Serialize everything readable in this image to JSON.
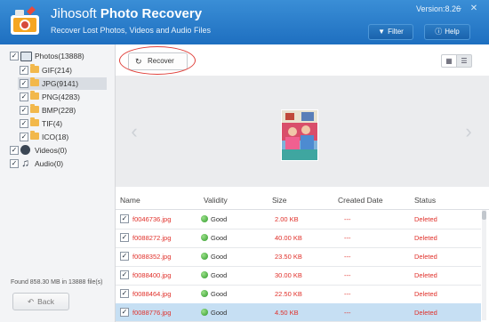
{
  "header": {
    "app_name_light": "Jihosoft ",
    "app_name_bold": "Photo Recovery",
    "subtitle": "Recover Lost Photos, Videos and Audio Files",
    "version": "Version:8.26",
    "filter_label": "Filter",
    "help_label": "Help",
    "accent": "#2b7fcf"
  },
  "sidebar": {
    "items": [
      {
        "label": "Photos(13888)",
        "icon": "photos-icon"
      },
      {
        "label": "GIF(214)",
        "icon": "folder-icon"
      },
      {
        "label": "JPG(9141)",
        "icon": "folder-icon",
        "selected": true
      },
      {
        "label": "PNG(4283)",
        "icon": "folder-icon"
      },
      {
        "label": "BMP(228)",
        "icon": "folder-icon"
      },
      {
        "label": "TIF(4)",
        "icon": "folder-icon"
      },
      {
        "label": "ICO(18)",
        "icon": "folder-icon"
      },
      {
        "label": "Videos(0)",
        "icon": "film-reel-icon"
      },
      {
        "label": "Audio(0)",
        "icon": "music-note-icon"
      }
    ],
    "found_text": "Found 858.30 MB in 13888 file(s)",
    "back_label": "Back"
  },
  "toolbar": {
    "recover_label": "Recover"
  },
  "table": {
    "columns": [
      "Name",
      "Validity",
      "Size",
      "Created Date",
      "Status"
    ],
    "rows": [
      {
        "name": "f0046736.jpg",
        "validity": "Good",
        "size": "2.00 KB",
        "created": "---",
        "status": "Deleted"
      },
      {
        "name": "f0088272.jpg",
        "validity": "Good",
        "size": "40.00 KB",
        "created": "---",
        "status": "Deleted"
      },
      {
        "name": "f0088352.jpg",
        "validity": "Good",
        "size": "23.50 KB",
        "created": "---",
        "status": "Deleted"
      },
      {
        "name": "f0088400.jpg",
        "validity": "Good",
        "size": "30.00 KB",
        "created": "---",
        "status": "Deleted"
      },
      {
        "name": "f0088464.jpg",
        "validity": "Good",
        "size": "22.50 KB",
        "created": "---",
        "status": "Deleted"
      },
      {
        "name": "f0088776.jpg",
        "validity": "Good",
        "size": "4.50 KB",
        "created": "---",
        "status": "Deleted",
        "selected": true
      }
    ]
  }
}
